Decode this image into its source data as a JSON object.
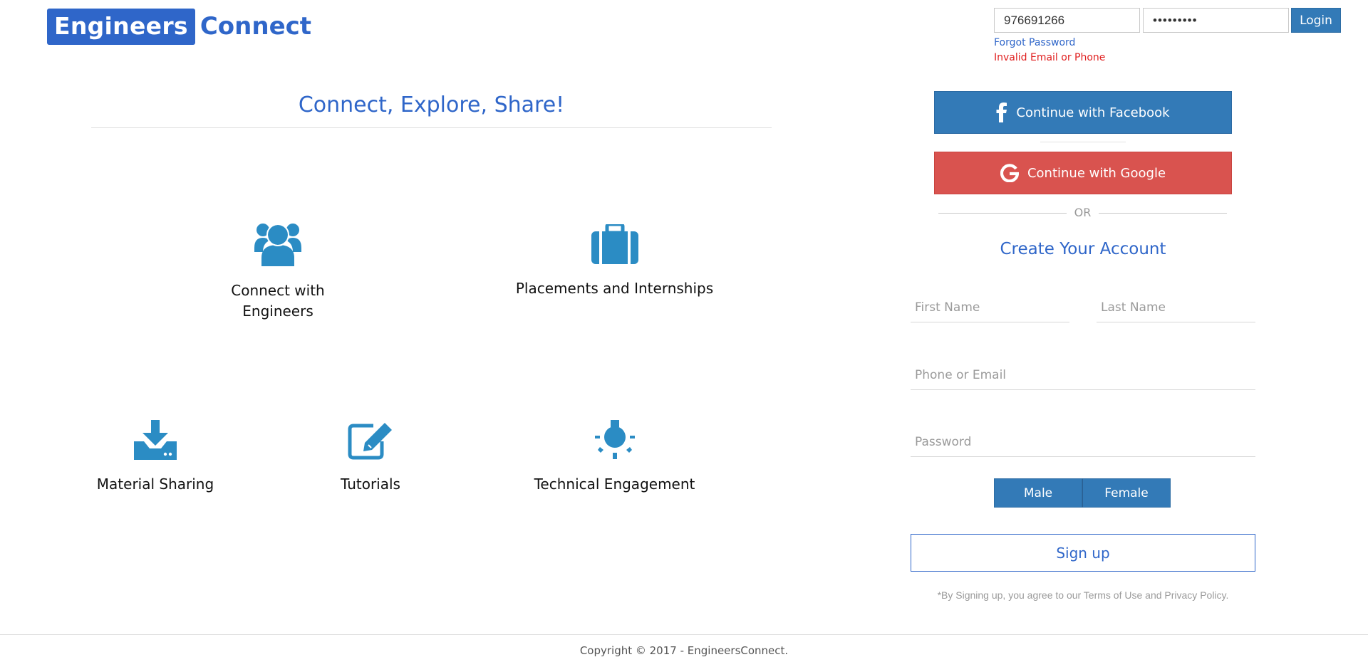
{
  "brand": {
    "part1": "Engineers",
    "part2": "Connect",
    "color": "#2f66c9"
  },
  "login": {
    "user_value": "976691266",
    "password_value": "•••••••••",
    "button_label": "Login",
    "forgot_label": "Forgot Password",
    "error_message": "Invalid Email or Phone"
  },
  "main": {
    "tagline": "Connect, Explore, Share!",
    "features": [
      {
        "label": "Connect with Engineers",
        "icon": "users-icon"
      },
      {
        "label": "Placements and Internships",
        "icon": "briefcase-icon"
      },
      {
        "label": "Material Sharing",
        "icon": "download-icon"
      },
      {
        "label": "Tutorials",
        "icon": "edit-icon"
      },
      {
        "label": "Technical Engagement",
        "icon": "lightbulb-icon"
      }
    ],
    "feature1_line1": "Connect with",
    "feature1_line2": "Engineers"
  },
  "signup": {
    "facebook_label": "Continue with Facebook",
    "google_label": "Continue with Google",
    "or_label": "OR",
    "title": "Create Your Account",
    "first_name_placeholder": "First Name",
    "last_name_placeholder": "Last Name",
    "contact_placeholder": "Phone or Email",
    "password_placeholder": "Password",
    "gender_male": "Male",
    "gender_female": "Female",
    "submit_label": "Sign up",
    "terms": "*By Signing up, you agree to our Terms of Use and Privacy Policy."
  },
  "footer": {
    "copyright": "Copyright © 2017 - EngineersConnect."
  },
  "colors": {
    "primary": "#337ab7",
    "accent_blue": "#2f66c9",
    "google_red": "#d9534f",
    "icon_blue": "#2b8cc4",
    "error_red": "#e02020"
  }
}
